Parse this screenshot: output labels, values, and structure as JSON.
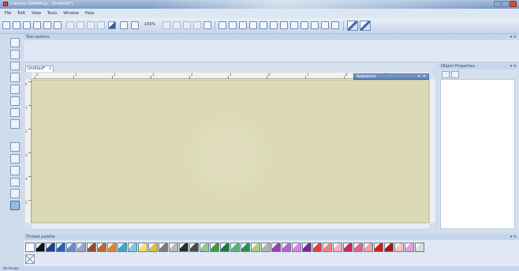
{
  "window": {
    "title": "Creative DRAWings - [Untitled*]"
  },
  "menu": [
    "File",
    "Edit",
    "View",
    "Tools",
    "Window",
    "Help"
  ],
  "toolbar": {
    "zoom": "100%"
  },
  "panels": {
    "tool_options": "Tool options",
    "object_properties": "Object Properties",
    "thread_palette": "Thread palette",
    "sequence": "Sequence"
  },
  "document": {
    "tab_label": "Untitled*",
    "tab_close": "x"
  },
  "status": {
    "left": "No design",
    "right": ""
  },
  "pin_label": "▾ ✕",
  "ruler": {
    "h": [
      "0",
      "1",
      "2",
      "3",
      "4",
      "5",
      "6",
      "7",
      "8",
      "9"
    ],
    "v": [
      "0",
      "1",
      "2",
      "3",
      "4",
      "5"
    ]
  },
  "colors": {
    "canvas": "#dcdab6",
    "thread_swatches": [
      "#ffffff",
      "#111111",
      "#1f3e8c",
      "#2d5fb6",
      "#6f86c4",
      "#9aa4c8",
      "#8a4e28",
      "#c0662a",
      "#e0842c",
      "#3fa8c0",
      "#7ec9d8",
      "#f0e070",
      "#d8c050",
      "#7a7a7a",
      "#b8b8b8",
      "#2a2a2a",
      "#4a4a4a",
      "#90c890",
      "#3c9c3c",
      "#1e7a3c",
      "#5fae70",
      "#2e8c58",
      "#a8d078",
      "#b0b0b0",
      "#9b3fae",
      "#c060c8",
      "#e080e0",
      "#6a2e8a",
      "#e04040",
      "#f08080",
      "#f5b0c0",
      "#c8285a",
      "#e86090",
      "#f0a0a0",
      "#d01c1c",
      "#a01818",
      "#f4c0c0",
      "#e0a0d0",
      "#dcdcdc"
    ]
  }
}
